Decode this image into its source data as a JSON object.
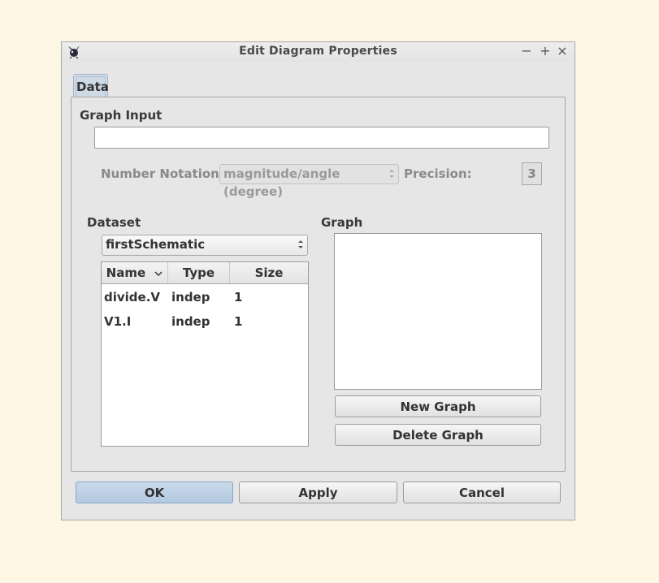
{
  "window": {
    "title": "Edit Diagram Properties",
    "controls": {
      "minimize": "−",
      "maximize": "+",
      "close": "×"
    }
  },
  "tabs": [
    {
      "label": "Data",
      "selected": true
    }
  ],
  "graph_input": {
    "label": "Graph Input",
    "value": ""
  },
  "notation": {
    "label": "Number Notation:",
    "selected": "magnitude/angle (degree)",
    "precision_label": "Precision:",
    "precision_value": "3"
  },
  "dataset": {
    "label": "Dataset",
    "selected": "firstSchematic",
    "columns": [
      "Name",
      "Type",
      "Size"
    ],
    "rows": [
      {
        "name": "divide.V",
        "type": "indep",
        "size": "1"
      },
      {
        "name": "V1.I",
        "type": "indep",
        "size": "1"
      }
    ]
  },
  "graph": {
    "label": "Graph",
    "new_label": "New Graph",
    "delete_label": "Delete Graph"
  },
  "footer": {
    "ok_label": "OK",
    "apply_label": "Apply",
    "cancel_label": "Cancel"
  },
  "colors": {
    "background": "#fdf6e3",
    "window": "#e6e6e6",
    "primary_button": "#b3c9e0"
  },
  "icons": {
    "app": "app-logo-icon",
    "sort": "chevron-down-icon",
    "combo": "updown-arrows-icon"
  }
}
